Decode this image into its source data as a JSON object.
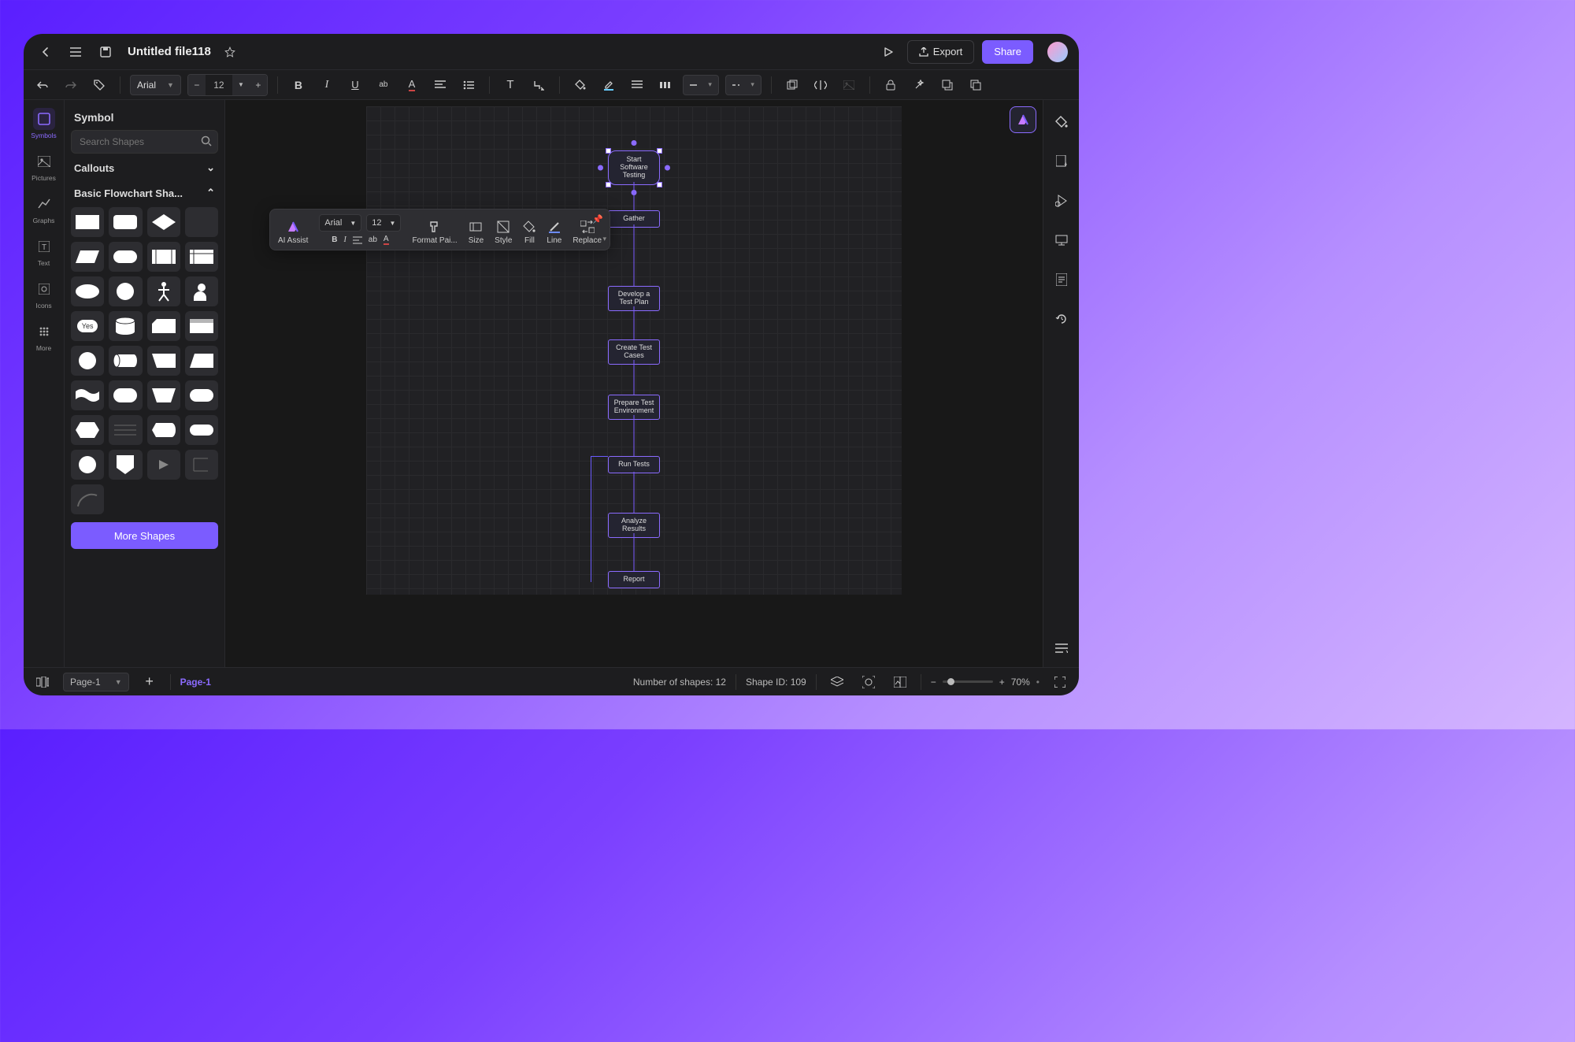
{
  "header": {
    "file_title": "Untitled file118",
    "export": "Export",
    "share": "Share"
  },
  "toolbar": {
    "font": "Arial",
    "font_size": "12"
  },
  "left_rail": [
    {
      "key": "symbols",
      "label": "Symbols"
    },
    {
      "key": "pictures",
      "label": "Pictures"
    },
    {
      "key": "graphs",
      "label": "Graphs"
    },
    {
      "key": "text",
      "label": "Text"
    },
    {
      "key": "icons",
      "label": "Icons"
    },
    {
      "key": "more",
      "label": "More"
    }
  ],
  "symbol_panel": {
    "title": "Symbol",
    "search_placeholder": "Search Shapes",
    "section_callouts": "Callouts",
    "section_basic": "Basic Flowchart Sha...",
    "more_shapes": "More Shapes"
  },
  "mini_toolbar": {
    "ai": "AI Assist",
    "font": "Arial",
    "size": "12",
    "format_painter": "Format Pai...",
    "lbl_size": "Size",
    "lbl_style": "Style",
    "lbl_fill": "Fill",
    "lbl_line": "Line",
    "lbl_replace": "Replace"
  },
  "flow_nodes": [
    "Start Software Testing",
    "Gather",
    "Develop a Test Plan",
    "Create Test Cases",
    "Prepare Test Environment",
    "Run Tests",
    "Analyze Results",
    "Report"
  ],
  "status": {
    "shapes_label": "Number of shapes:",
    "shapes_count": "12",
    "shape_id_label": "Shape ID:",
    "shape_id": "109",
    "zoom": "70%",
    "zoom_sep": "•",
    "page": "Page-1",
    "active_page": "Page-1"
  },
  "yes_shape_label": "Yes"
}
